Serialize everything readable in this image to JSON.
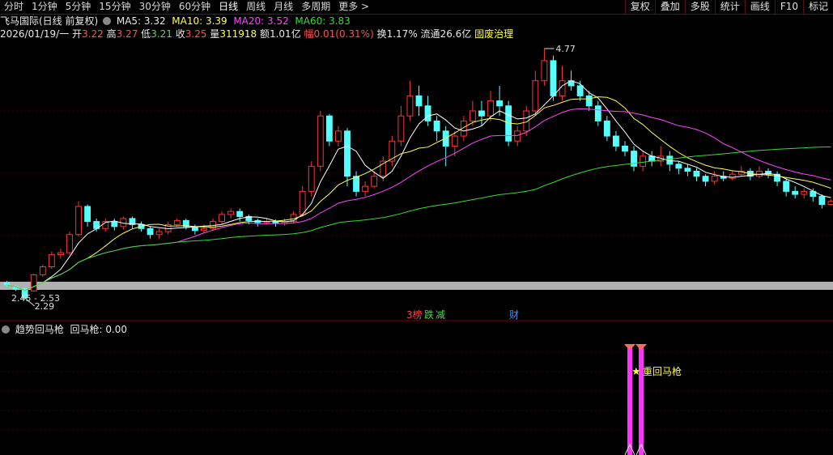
{
  "toolbar": {
    "periods": [
      "分时",
      "1分钟",
      "5分钟",
      "15分钟",
      "30分钟",
      "60分钟",
      "日线",
      "周线",
      "月线",
      "多周期",
      "更多 >"
    ],
    "active_period": "日线",
    "right_buttons": [
      "复权",
      "叠加",
      "多股",
      "统计",
      "画线",
      "F10",
      "标记"
    ]
  },
  "header": {
    "stock": "飞马国际(日线 前复权)",
    "ma5": "MA5: 3.32",
    "ma10": "MA10: 3.39",
    "ma20": "MA20: 3.52",
    "ma60": "MA60: 3.83"
  },
  "quote": {
    "date": "2026/01/19/一",
    "open_label": "开",
    "open": "3.22",
    "high_label": "高",
    "high": "3.27",
    "low_label": "低",
    "low": "3.21",
    "close_label": "收",
    "close": "3.25",
    "volume_label": "量",
    "volume": "311918",
    "amount_label": "额",
    "amount": "1.01亿",
    "change_label": "幅",
    "change": "0.01(0.31%)",
    "turnover_label": "换",
    "turnover": "1.17%",
    "float_label": "流通",
    "float": "26.6亿",
    "concept": "固废治理"
  },
  "annotations": {
    "high_mark": "4.77",
    "low_mark": "2.29",
    "range_label": "2.45 - 2.53",
    "event_tags": [
      {
        "text": "3榜",
        "color": "#ff4444"
      },
      {
        "text": "跌",
        "color": "#44dd44"
      },
      {
        "text": "减",
        "color": "#44dd44"
      },
      {
        "text": "财",
        "color": "#4488ff"
      }
    ]
  },
  "indicator": {
    "name": "趋势回马枪",
    "label": "回马枪: 0.00",
    "signal_text": "重回马枪"
  },
  "colors": {
    "up": "#ff3333",
    "down": "#55ffff",
    "ma5": "#ffffff",
    "ma10": "#ffff55",
    "ma20": "#ff44ff",
    "ma60": "#33dd33",
    "signal": "#ff33ff"
  },
  "chart_data": {
    "type": "candlestick",
    "price_range": [
      2.29,
      4.77
    ],
    "candles": [
      [
        2.44,
        2.42,
        2.46,
        2.4
      ],
      [
        2.4,
        2.38,
        2.42,
        2.36
      ],
      [
        2.38,
        2.29,
        2.39,
        2.29
      ],
      [
        2.36,
        2.52,
        2.53,
        2.35
      ],
      [
        2.52,
        2.6,
        2.62,
        2.5
      ],
      [
        2.6,
        2.72,
        2.75,
        2.58
      ],
      [
        2.72,
        2.74,
        2.78,
        2.68
      ],
      [
        2.74,
        2.92,
        2.95,
        2.72
      ],
      [
        2.92,
        3.2,
        3.25,
        2.9
      ],
      [
        3.2,
        3.05,
        3.22,
        3.0
      ],
      [
        3.05,
        2.98,
        3.08,
        2.95
      ],
      [
        2.98,
        3.05,
        3.08,
        2.95
      ],
      [
        3.05,
        3.0,
        3.08,
        2.96
      ],
      [
        3.0,
        3.08,
        3.1,
        2.97
      ],
      [
        3.08,
        3.02,
        3.1,
        2.98
      ],
      [
        3.02,
        2.98,
        3.05,
        2.95
      ],
      [
        2.98,
        2.92,
        3.0,
        2.88
      ],
      [
        2.92,
        2.95,
        2.98,
        2.88
      ],
      [
        2.95,
        3.02,
        3.05,
        2.92
      ],
      [
        3.02,
        3.06,
        3.08,
        3.0
      ],
      [
        3.06,
        3.0,
        3.08,
        2.97
      ],
      [
        3.0,
        2.96,
        3.02,
        2.92
      ],
      [
        2.96,
        2.98,
        3.02,
        2.94
      ],
      [
        2.98,
        3.05,
        3.08,
        2.96
      ],
      [
        3.05,
        3.12,
        3.15,
        3.02
      ],
      [
        3.12,
        3.15,
        3.18,
        3.08
      ],
      [
        3.15,
        3.1,
        3.18,
        3.05
      ],
      [
        3.1,
        3.06,
        3.12,
        3.02
      ],
      [
        3.06,
        3.04,
        3.08,
        3.0
      ],
      [
        3.04,
        3.05,
        3.08,
        3.02
      ],
      [
        3.05,
        3.03,
        3.07,
        3.0
      ],
      [
        3.03,
        3.05,
        3.08,
        3.01
      ],
      [
        3.05,
        3.12,
        3.15,
        3.03
      ],
      [
        3.12,
        3.35,
        3.4,
        3.1
      ],
      [
        3.35,
        3.6,
        3.65,
        3.3
      ],
      [
        3.6,
        4.1,
        4.15,
        3.55
      ],
      [
        4.1,
        3.85,
        4.12,
        3.8
      ],
      [
        3.85,
        3.95,
        4.0,
        3.8
      ],
      [
        3.95,
        3.5,
        3.98,
        3.4
      ],
      [
        3.5,
        3.35,
        3.55,
        3.3
      ],
      [
        3.35,
        3.4,
        3.45,
        3.3
      ],
      [
        3.4,
        3.5,
        3.55,
        3.38
      ],
      [
        3.5,
        3.65,
        3.7,
        3.45
      ],
      [
        3.65,
        3.85,
        3.9,
        3.6
      ],
      [
        3.85,
        4.1,
        4.2,
        3.8
      ],
      [
        4.1,
        4.3,
        4.45,
        4.05
      ],
      [
        4.3,
        4.2,
        4.4,
        4.1
      ],
      [
        4.2,
        4.05,
        4.3,
        4.0
      ],
      [
        4.05,
        3.95,
        4.1,
        3.85
      ],
      [
        3.95,
        3.8,
        4.0,
        3.6
      ],
      [
        3.8,
        3.9,
        3.95,
        3.7
      ],
      [
        3.9,
        4.05,
        4.1,
        3.85
      ],
      [
        4.05,
        4.15,
        4.25,
        4.0
      ],
      [
        4.15,
        4.1,
        4.25,
        4.0
      ],
      [
        4.1,
        4.25,
        4.35,
        4.05
      ],
      [
        4.25,
        4.2,
        4.4,
        4.1
      ],
      [
        4.2,
        3.85,
        4.25,
        3.8
      ],
      [
        3.85,
        3.95,
        4.0,
        3.8
      ],
      [
        3.95,
        4.15,
        4.2,
        3.9
      ],
      [
        4.15,
        4.45,
        4.55,
        4.1
      ],
      [
        4.45,
        4.65,
        4.77,
        4.4
      ],
      [
        4.65,
        4.3,
        4.7,
        4.25
      ],
      [
        4.3,
        4.45,
        4.6,
        4.25
      ],
      [
        4.45,
        4.4,
        4.55,
        4.35
      ],
      [
        4.4,
        4.3,
        4.45,
        4.25
      ],
      [
        4.3,
        4.2,
        4.35,
        4.15
      ],
      [
        4.2,
        4.05,
        4.25,
        4.0
      ],
      [
        4.05,
        3.9,
        4.1,
        3.85
      ],
      [
        3.9,
        3.8,
        3.95,
        3.75
      ],
      [
        3.8,
        3.75,
        3.85,
        3.7
      ],
      [
        3.75,
        3.6,
        3.8,
        3.55
      ],
      [
        3.6,
        3.7,
        3.75,
        3.55
      ],
      [
        3.7,
        3.65,
        3.75,
        3.6
      ],
      [
        3.65,
        3.7,
        3.8,
        3.6
      ],
      [
        3.7,
        3.62,
        3.75,
        3.55
      ],
      [
        3.62,
        3.58,
        3.65,
        3.52
      ],
      [
        3.58,
        3.55,
        3.62,
        3.5
      ],
      [
        3.55,
        3.5,
        3.58,
        3.45
      ],
      [
        3.5,
        3.45,
        3.52,
        3.4
      ],
      [
        3.45,
        3.5,
        3.55,
        3.42
      ],
      [
        3.5,
        3.48,
        3.55,
        3.45
      ],
      [
        3.48,
        3.52,
        3.55,
        3.46
      ],
      [
        3.52,
        3.55,
        3.6,
        3.5
      ],
      [
        3.55,
        3.5,
        3.58,
        3.46
      ],
      [
        3.5,
        3.55,
        3.6,
        3.48
      ],
      [
        3.55,
        3.52,
        3.58,
        3.48
      ],
      [
        3.52,
        3.45,
        3.55,
        3.4
      ],
      [
        3.45,
        3.35,
        3.48,
        3.3
      ],
      [
        3.35,
        3.32,
        3.4,
        3.28
      ],
      [
        3.32,
        3.35,
        3.38,
        3.28
      ],
      [
        3.35,
        3.3,
        3.38,
        3.25
      ],
      [
        3.3,
        3.22,
        3.32,
        3.18
      ],
      [
        3.22,
        3.25,
        3.27,
        3.21
      ]
    ]
  }
}
